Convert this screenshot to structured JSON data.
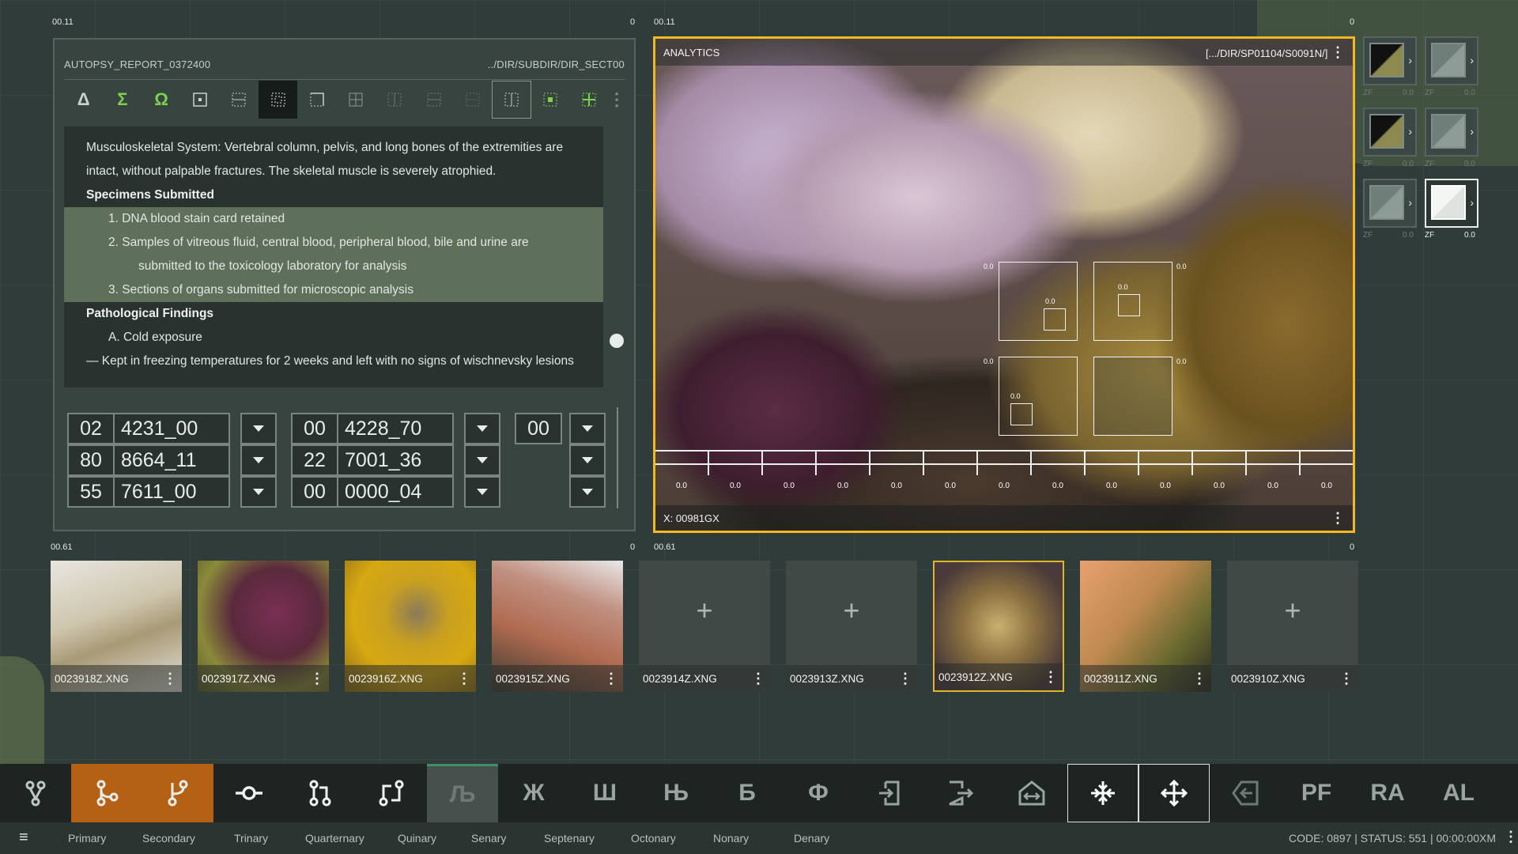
{
  "corner_labels": {
    "left_panel_tl": "00.11",
    "left_panel_tr": "0",
    "viewer_tl": "00.11",
    "viewer_tr": "0",
    "thumbs_left_tl": "00.61",
    "thumbs_left_tr": "0",
    "thumbs_right_tl": "00.61",
    "thumbs_right_tr": "0"
  },
  "report": {
    "title": "AUTOPSY_REPORT_0372400",
    "path": "../DIR/SUBDIR/DIR_SECT00",
    "toolbar_glyphs": [
      "Δ",
      "Σ",
      "Ω",
      "⊡",
      "▦",
      "▦",
      "▢",
      "⊞",
      "⊞",
      "⊟",
      "⊟",
      "⊞",
      "⊞",
      "⊞"
    ],
    "lines": [
      "Musculoskeletal System: Vertebral column, pelvis, and long bones of the extremities are",
      "intact, without palpable fractures. The skeletal muscle is severely atrophied.",
      "Specimens Submitted",
      "1. DNA blood stain card retained",
      "2. Samples of vitreous fluid, central blood, peripheral blood, bile and urine are",
      "submitted to the toxicology laboratory for analysis",
      "3. Sections of organs submitted for microscopic analysis",
      "Pathological Findings",
      "A. Cold exposure",
      "— Kept in freezing temperatures for 2 weeks and left with no signs of wischnevsky lesions"
    ]
  },
  "fields": {
    "group1": [
      {
        "code": "02",
        "value": "4231_00"
      },
      {
        "code": "80",
        "value": "8664_11"
      },
      {
        "code": "55",
        "value": "7611_00"
      }
    ],
    "group2": [
      {
        "code": "00",
        "value": "4228_70"
      },
      {
        "code": "22",
        "value": "7001_36"
      },
      {
        "code": "00",
        "value": "0000_04"
      }
    ],
    "group3": {
      "code": "00"
    }
  },
  "viewer": {
    "title": "ANALYTICS",
    "path": "[.../DIR/SP01104/S0091N/]",
    "footer": "X: 00981GX",
    "roi_value": "0.0",
    "tick_value": "0.0"
  },
  "side_panel": {
    "zf_label": "ZF",
    "zf_value": "0.0"
  },
  "thumbnails": [
    "0023918Z.XNG",
    "0023917Z.XNG",
    "0023916Z.XNG",
    "0023915Z.XNG",
    "0023914Z.XNG",
    "0023913Z.XNG",
    "0023912Z.XNG",
    "0023911Z.XNG",
    "0023910Z.XNG"
  ],
  "taskbar": {
    "cyrillic": [
      "Љ",
      "Ж",
      "Ш",
      "Њ",
      "Б",
      "Ф"
    ],
    "latin": [
      "PF",
      "RA",
      "AL"
    ]
  },
  "statusbar": {
    "tabs": [
      "Primary",
      "Secondary",
      "Trinary",
      "Quarternary",
      "Quinary",
      "Senary",
      "Septenary",
      "Octonary",
      "Nonary",
      "Denary"
    ],
    "status": "CODE: 0897 | STATUS: 551 | 00:00:00XM"
  },
  "colors": {
    "accent_yellow": "#f2b824",
    "accent_orange": "#b56113",
    "accent_green": "#7bd14e"
  }
}
